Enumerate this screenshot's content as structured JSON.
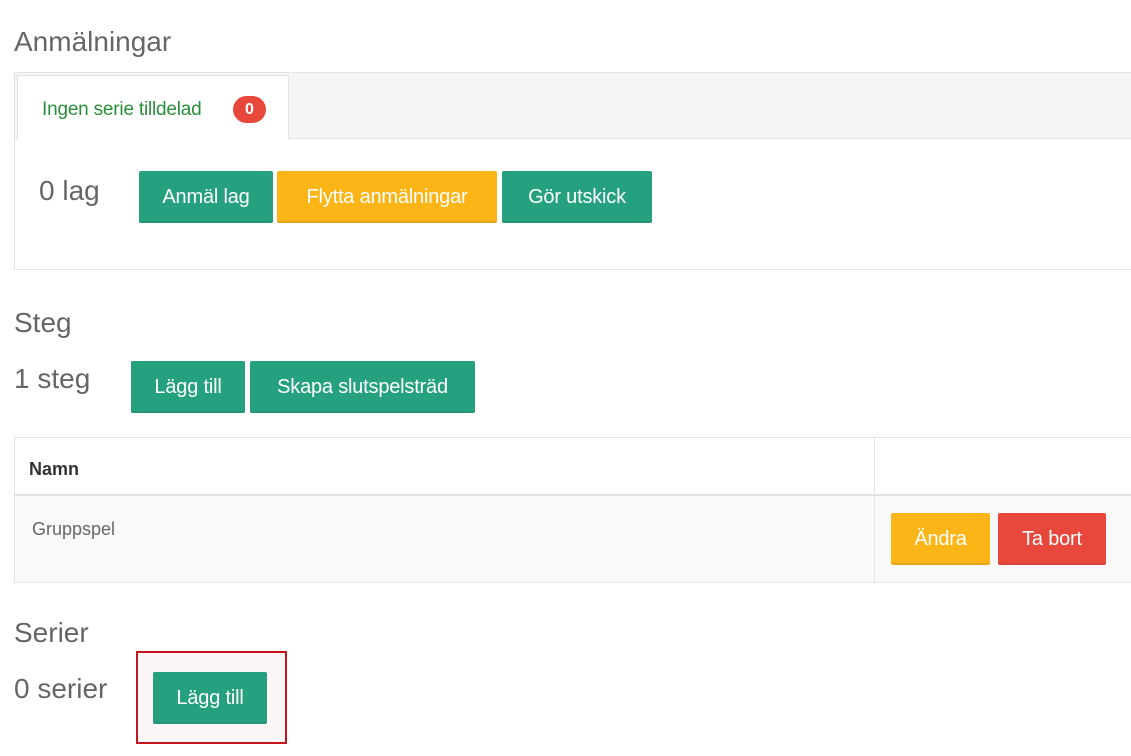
{
  "registrations": {
    "title": "Anmälningar",
    "tab_label": "Ingen serie tilldelad",
    "tab_badge": "0",
    "count_text": "0 lag",
    "buttons": {
      "register_team": "Anmäl lag",
      "move_registrations": "Flytta anmälningar",
      "send_mailing": "Gör utskick"
    }
  },
  "stages": {
    "title": "Steg",
    "count_text": "1 steg",
    "buttons": {
      "add": "Lägg till",
      "create_playoff_tree": "Skapa slutspelsträd"
    },
    "table": {
      "header_name": "Namn",
      "rows": [
        {
          "name": "Gruppspel",
          "edit_label": "Ändra",
          "delete_label": "Ta bort"
        }
      ]
    }
  },
  "series": {
    "title": "Serier",
    "count_text": "0 serier",
    "buttons": {
      "add": "Lägg till"
    }
  },
  "colors": {
    "primary_green": "#26a17f",
    "warning_yellow": "#fcb517",
    "danger_red": "#e8483b",
    "tab_green_text": "#2a8f3a",
    "highlight_red": "#c4161c"
  }
}
